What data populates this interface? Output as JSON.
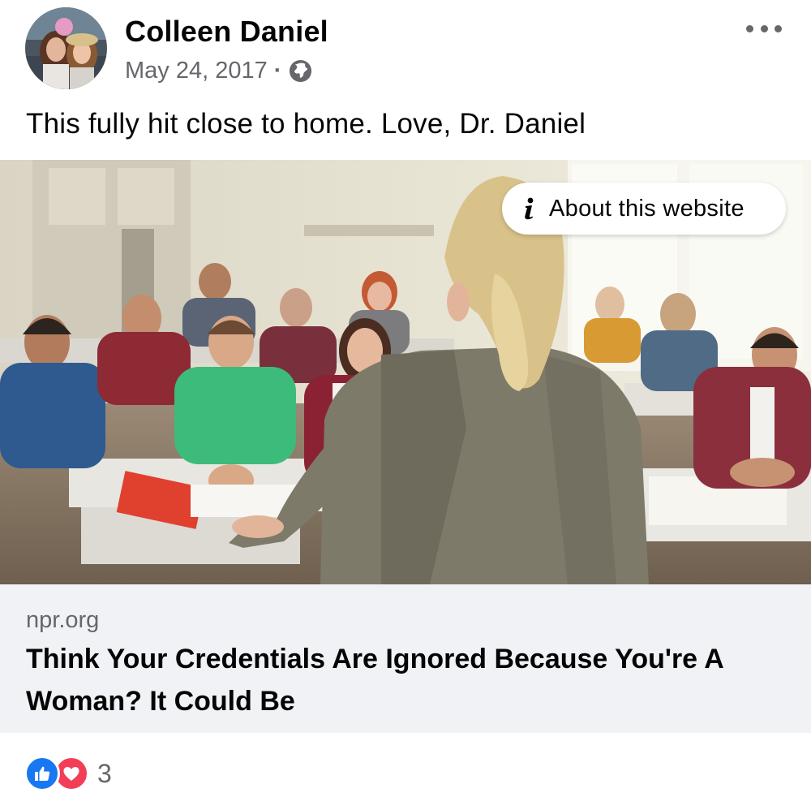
{
  "post": {
    "author": "Colleen Daniel",
    "timestamp": "May 24, 2017",
    "separator": "·",
    "privacy_icon": "globe-icon",
    "more_icon": "more-horizontal-icon",
    "message": "This fully hit close to home. Love, Dr. Daniel"
  },
  "link_preview": {
    "about_label": "About this website",
    "about_icon": "info-icon",
    "domain": "npr.org",
    "headline": "Think Your Credentials Are Ignored Because You're A Woman? It Could Be"
  },
  "reactions": {
    "icons": [
      "like-icon",
      "love-icon"
    ],
    "count": "3"
  },
  "colors": {
    "brand_blue": "#1877f2",
    "love_red": "#f33e58",
    "secondary_text": "#65676b",
    "card_background": "#f0f2f5"
  }
}
